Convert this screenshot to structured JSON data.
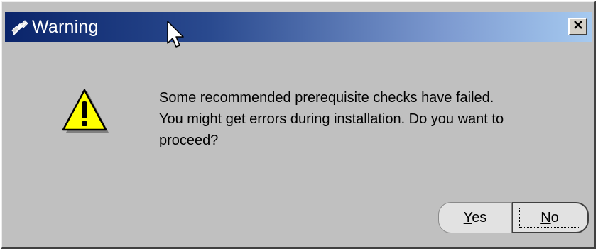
{
  "window": {
    "title": "Warning",
    "title_icon": "satellite-icon",
    "close_icon": "close-icon"
  },
  "dialog": {
    "icon": "warning-icon",
    "message_lines": [
      "Some recommended prerequisite checks have failed.",
      "You might get errors during installation. Do you want to",
      "proceed?"
    ]
  },
  "buttons": {
    "yes": {
      "mnemonic": "Y",
      "rest": "es"
    },
    "no": {
      "mnemonic": "N",
      "rest": "o"
    }
  },
  "colors": {
    "titlebar_start": "#0a246a",
    "titlebar_end": "#a6caf0",
    "dialog_bg": "#c0c0c0",
    "warning_yellow": "#ffff00"
  }
}
